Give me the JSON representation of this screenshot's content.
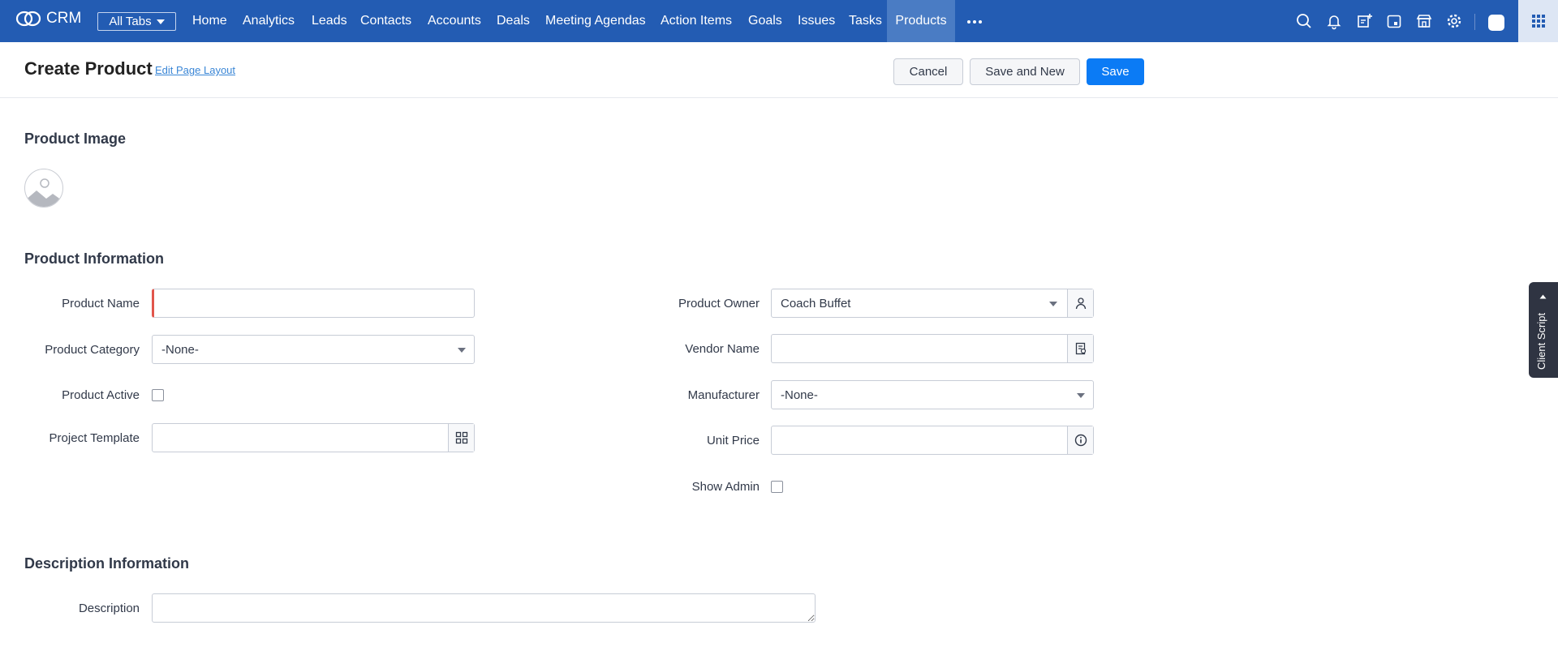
{
  "app": {
    "name": "CRM",
    "all_tabs_label": "All Tabs"
  },
  "nav": {
    "tabs": [
      {
        "label": "Home"
      },
      {
        "label": "Analytics"
      },
      {
        "label": "Leads"
      },
      {
        "label": "Contacts"
      },
      {
        "label": "Accounts"
      },
      {
        "label": "Deals"
      },
      {
        "label": "Meeting Agendas"
      },
      {
        "label": "Action Items"
      },
      {
        "label": "Goals"
      },
      {
        "label": "Issues"
      },
      {
        "label": "Tasks"
      },
      {
        "label": "Products",
        "active": true
      }
    ],
    "icons": [
      "search-icon",
      "bell-icon",
      "add-note-icon",
      "calendar-icon",
      "marketplace-icon",
      "gear-icon",
      "avatar",
      "app-grid-icon"
    ]
  },
  "header": {
    "title": "Create Product",
    "edit_layout_link": "Edit Page Layout",
    "cancel_label": "Cancel",
    "save_new_label": "Save and New",
    "save_label": "Save"
  },
  "sections": {
    "image": {
      "title": "Product Image"
    },
    "info": {
      "title": "Product Information",
      "product_name": {
        "label": "Product Name",
        "value": ""
      },
      "product_category": {
        "label": "Product Category",
        "value": "-None-"
      },
      "product_active": {
        "label": "Product Active",
        "checked": false
      },
      "project_template": {
        "label": "Project Template",
        "value": ""
      },
      "product_owner": {
        "label": "Product Owner",
        "value": "Coach Buffet"
      },
      "vendor_name": {
        "label": "Vendor Name",
        "value": ""
      },
      "manufacturer": {
        "label": "Manufacturer",
        "value": "-None-"
      },
      "unit_price": {
        "label": "Unit Price",
        "value": ""
      },
      "show_admin": {
        "label": "Show Admin",
        "checked": false
      }
    },
    "description": {
      "title": "Description Information",
      "description": {
        "label": "Description",
        "value": ""
      }
    }
  },
  "client_script": {
    "label": "Client Script"
  },
  "colors": {
    "topbar": "#235cb3",
    "active_tab": "#4a7cc4",
    "primary_button": "#0b7bf5",
    "required": "#e1554b"
  }
}
